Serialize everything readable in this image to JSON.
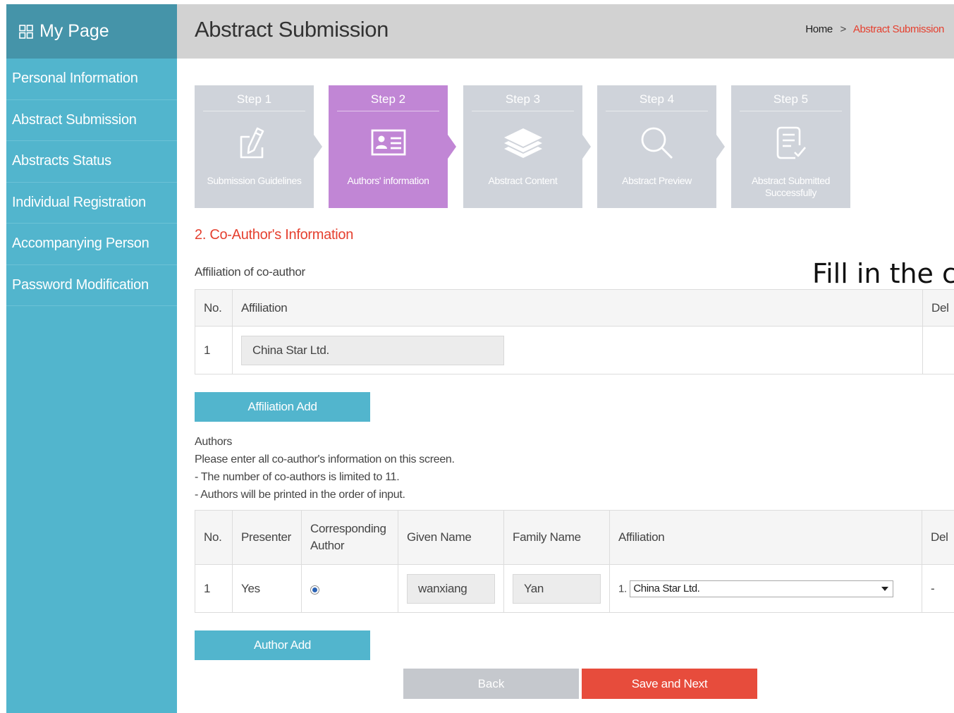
{
  "sidebar": {
    "title": "My Page",
    "items": [
      {
        "label": "Personal Information"
      },
      {
        "label": "Abstract Submission"
      },
      {
        "label": "Abstracts Status"
      },
      {
        "label": "Individual Registration"
      },
      {
        "label": "Accompanying Person"
      },
      {
        "label": "Password Modification"
      }
    ]
  },
  "header": {
    "title": "Abstract Submission",
    "breadcrumb": {
      "home": "Home",
      "separator": ">",
      "current": "Abstract Submission"
    }
  },
  "steps": [
    {
      "title": "Step 1",
      "label": "Submission Guidelines",
      "icon": "edit-document-icon",
      "active": false
    },
    {
      "title": "Step 2",
      "label": "Authors' information",
      "icon": "id-card-icon",
      "active": true
    },
    {
      "title": "Step 3",
      "label": "Abstract Content",
      "icon": "layers-icon",
      "active": false
    },
    {
      "title": "Step 4",
      "label": "Abstract Preview",
      "icon": "search-icon",
      "active": false
    },
    {
      "title": "Step 5",
      "label": "Abstract Submitted Successfully",
      "icon": "document-check-icon",
      "active": false
    }
  ],
  "section_title": "2. Co-Author's Information",
  "overlay_text": "Fill in the c",
  "affiliation": {
    "label": "Affiliation of co-author",
    "columns": [
      "No.",
      "Affiliation",
      "Del"
    ],
    "rows": [
      {
        "no": "1",
        "affiliation": "China Star Ltd.",
        "del": ""
      }
    ],
    "add_button": "Affiliation Add"
  },
  "authors": {
    "heading": "Authors",
    "notes": [
      "Please enter all co-author's information on this screen.",
      "- The number of co-authors is limited to 11.",
      "- Authors will be printed in the order of input."
    ],
    "columns": [
      "No.",
      "Presenter",
      "Corresponding Author",
      "Given Name",
      "Family Name",
      "Affiliation",
      "Del"
    ],
    "rows": [
      {
        "no": "1",
        "presenter": "Yes",
        "corresponding": true,
        "given_name": "wanxiang",
        "family_name": "Yan",
        "affiliation_prefix": "1.",
        "affiliation_value": "China Star Ltd.",
        "del": "-"
      }
    ],
    "add_button": "Author Add"
  },
  "buttons": {
    "back": "Back",
    "save_next": "Save and Next"
  },
  "colors": {
    "sidebar": "#52b5cd",
    "sidebar_head": "#4594a9",
    "step_active": "#c186d5",
    "step_inactive": "#cfd3da",
    "accent_red": "#e5402f"
  }
}
